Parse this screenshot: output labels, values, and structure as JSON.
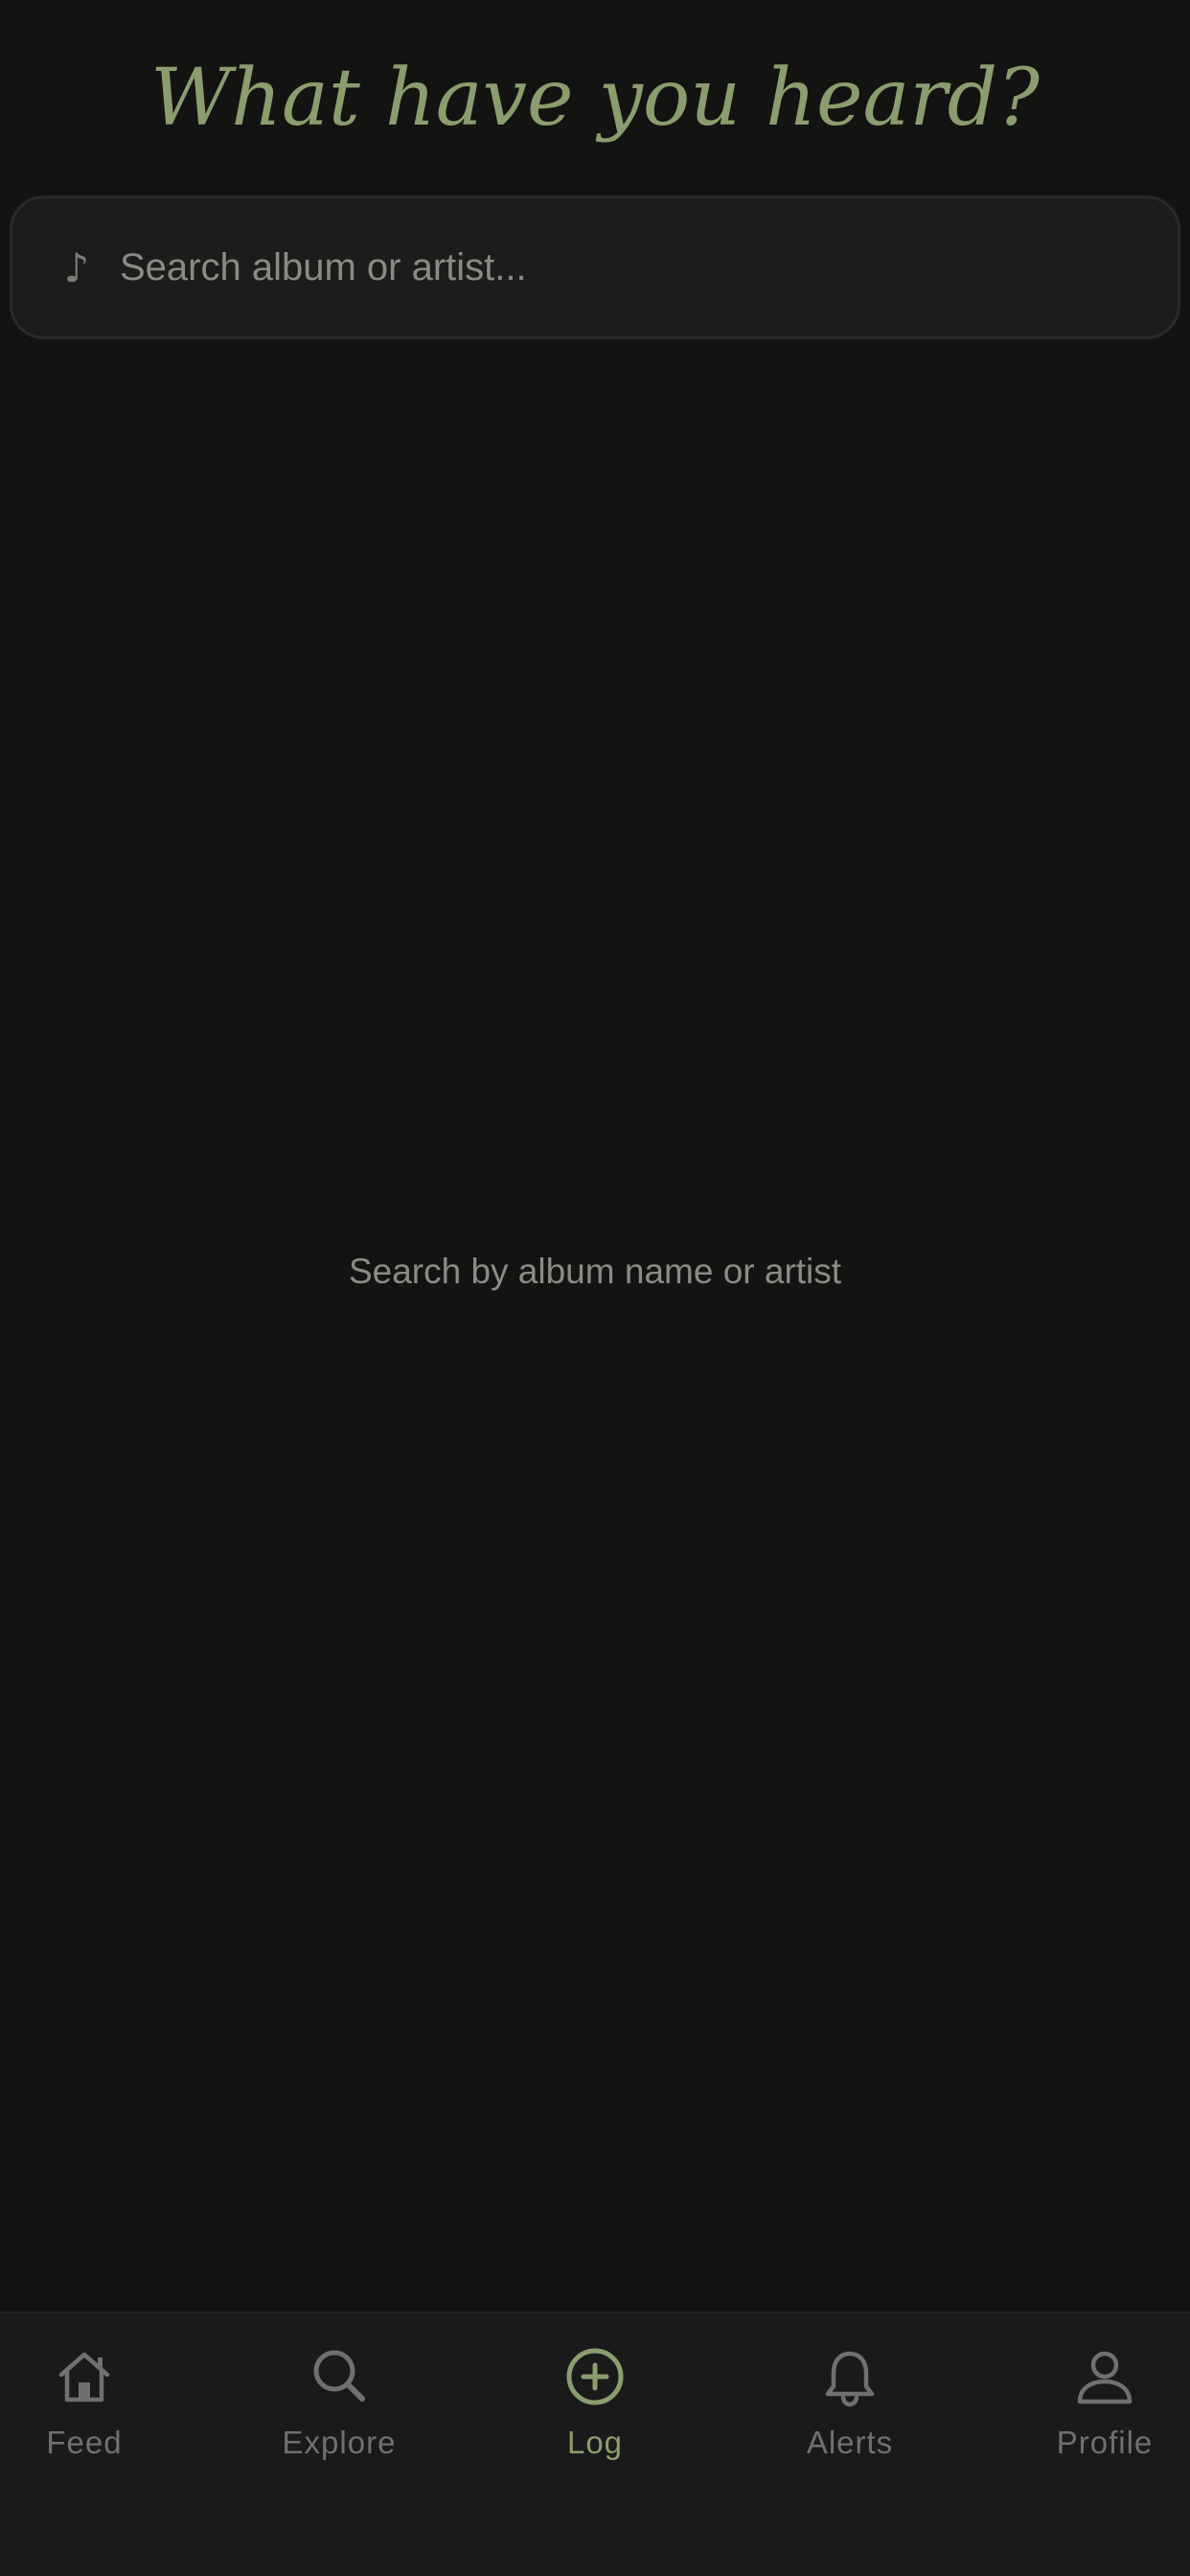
{
  "header": {
    "title": "What have you heard?"
  },
  "search": {
    "icon": "music-note-icon",
    "placeholder": "Search album or artist...",
    "value": ""
  },
  "empty_state": {
    "hint": "Search by album name or artist"
  },
  "tabbar": {
    "active": "Log",
    "tabs": [
      {
        "label": "Feed",
        "icon": "home-icon"
      },
      {
        "label": "Explore",
        "icon": "search-icon"
      },
      {
        "label": "Log",
        "icon": "plus-circle-icon"
      },
      {
        "label": "Alerts",
        "icon": "bell-icon"
      },
      {
        "label": "Profile",
        "icon": "user-icon"
      }
    ]
  },
  "colors": {
    "background": "#131312",
    "accent": "#8b9d6e",
    "muted": "#707070",
    "tabbar": "#1a1a1a"
  }
}
